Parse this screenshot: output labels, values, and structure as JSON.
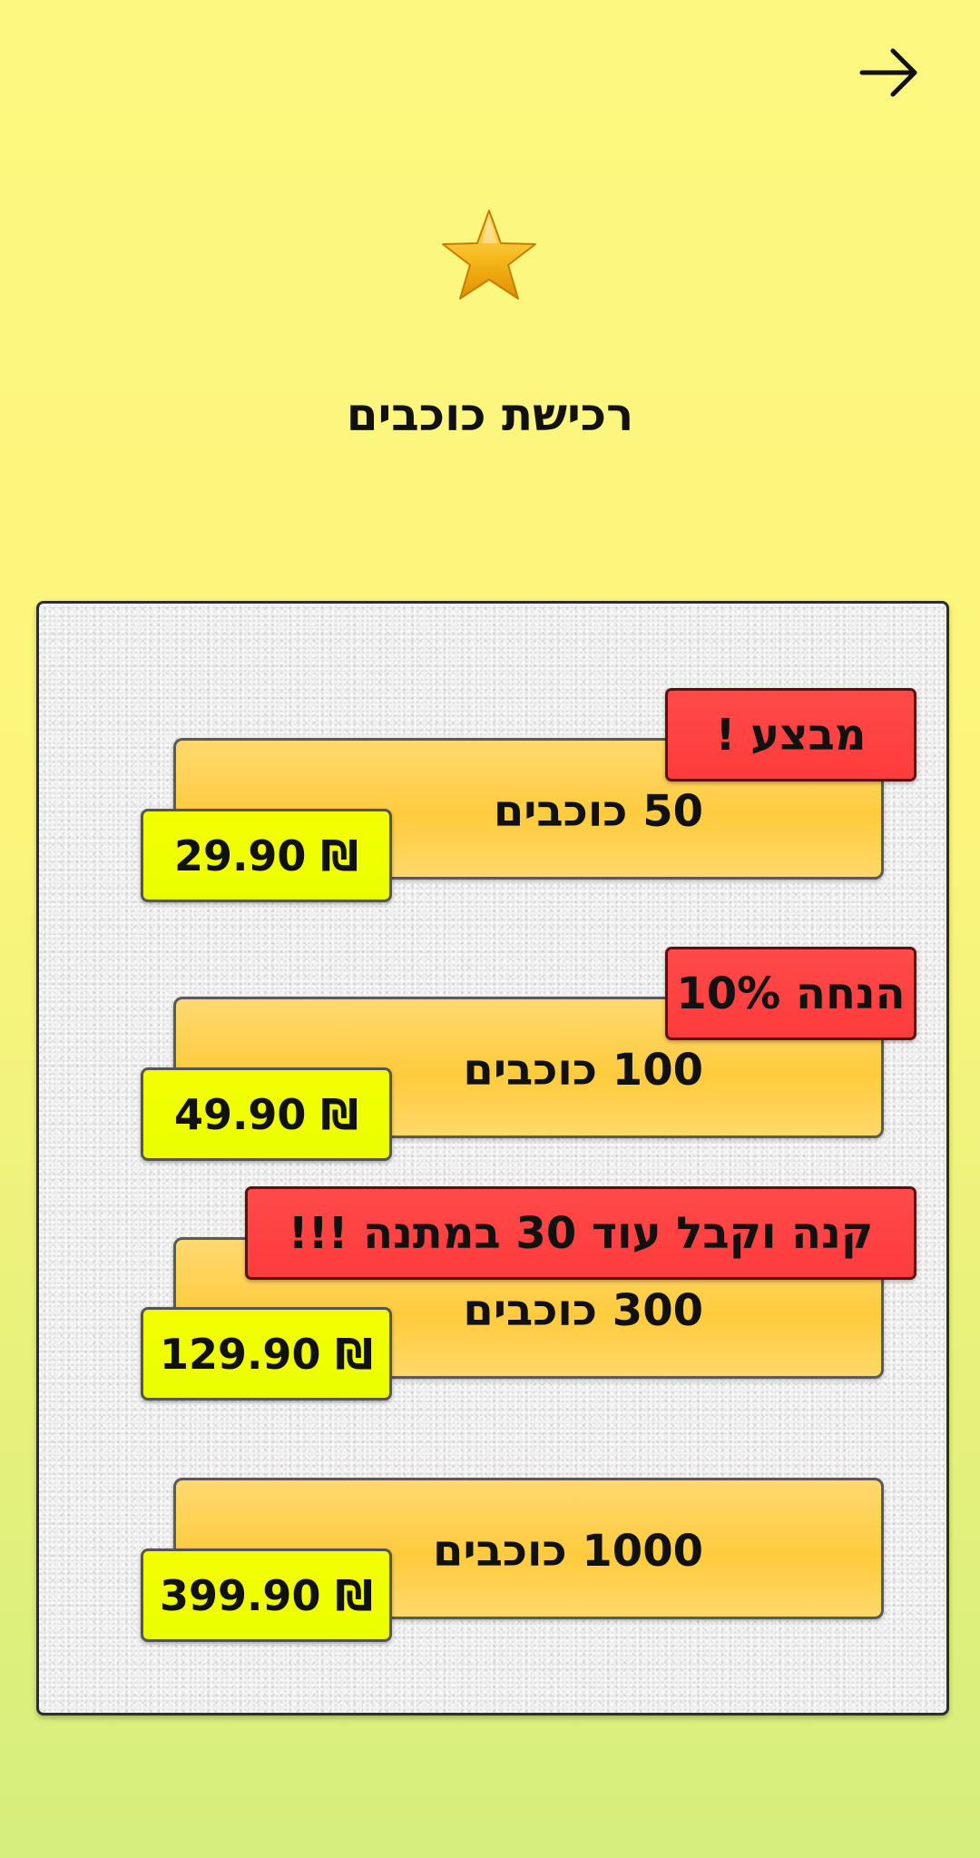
{
  "header": {
    "back_icon": "arrow-right-icon",
    "star_icon": "star-icon",
    "title": "רכישת כוכבים"
  },
  "packages": [
    {
      "label": "50 כוכבים",
      "price": "29.90 ₪",
      "badge": "מבצע !"
    },
    {
      "label": "100 כוכבים",
      "price": "49.90 ₪",
      "badge": "הנחה 10%"
    },
    {
      "label": "300 כוכבים",
      "price": "129.90 ₪",
      "badge": "קנה וקבל עוד 30 במתנה !!!"
    },
    {
      "label": "1000 כוכבים",
      "price": "399.90 ₪"
    }
  ],
  "colors": {
    "background_top": "#fdf87f",
    "background_bottom": "#d5ee7d",
    "package_button": "#ffcb3d",
    "price_tag": "#eaff00",
    "badge": "#ff3b3b",
    "star": "#f6b81a"
  }
}
